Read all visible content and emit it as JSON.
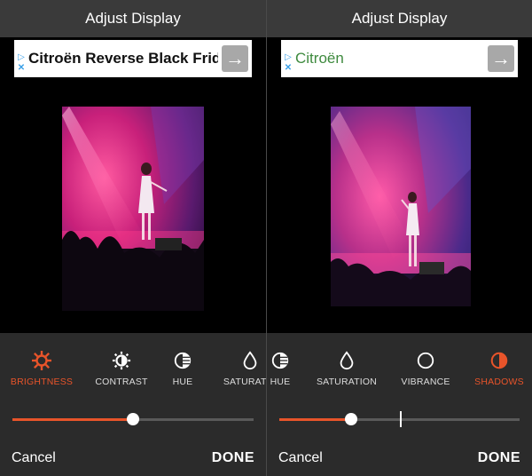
{
  "left": {
    "title": "Adjust Display",
    "ad_text": "Citroën Reverse Black Frida",
    "tools": [
      {
        "label": "BRIGHTNESS",
        "icon": "sun-icon",
        "active": true
      },
      {
        "label": "CONTRAST",
        "icon": "contrast-icon",
        "active": false
      },
      {
        "label": "HUE",
        "icon": "hue-icon",
        "active": false
      },
      {
        "label": "SATURATIO",
        "icon": "drop-icon",
        "active": false
      }
    ],
    "slider_value": 0.5,
    "cancel_label": "Cancel",
    "done_label": "DONE"
  },
  "right": {
    "title": "Adjust Display",
    "ad_text": "Citroën",
    "tools": [
      {
        "label": "HUE",
        "icon": "hue-icon",
        "active": false
      },
      {
        "label": "SATURATION",
        "icon": "drop-icon",
        "active": false
      },
      {
        "label": "VIBRANCE",
        "icon": "circle-icon",
        "active": false
      },
      {
        "label": "SHADOWS",
        "icon": "half-circle-icon",
        "active": true
      }
    ],
    "slider_value": 0.3,
    "cancel_label": "Cancel",
    "done_label": "DONE"
  },
  "colors": {
    "accent": "#e8542a",
    "header_bg": "#3a3a3a",
    "controls_bg": "#2b2b2b"
  }
}
